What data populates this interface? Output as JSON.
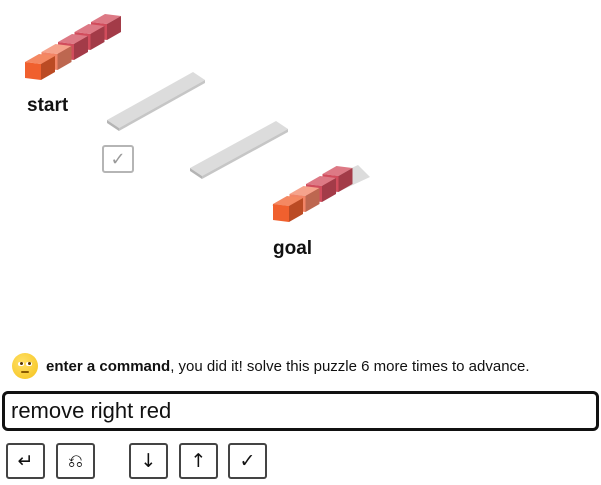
{
  "puzzle": {
    "start_label": "start",
    "goal_label": "goal",
    "done_check_glyph": "✓",
    "start_blocks": [
      "orange",
      "salmon",
      "red",
      "red",
      "red"
    ],
    "goal_blocks": [
      "orange",
      "salmon",
      "red",
      "red"
    ],
    "colors": {
      "orange": "#f0602e",
      "salmon": "#f28466",
      "red": "#d14c5c"
    }
  },
  "status": {
    "emoji_icon": "face-with-rolling-eyes-icon",
    "bold_text": "enter a command",
    "message": ", you did it! solve this puzzle 6 more times to advance."
  },
  "command": {
    "value": "remove right red"
  },
  "buttons": {
    "submit": "↵",
    "undo": "⎌",
    "down": "↓",
    "up": "↑",
    "check": "✓"
  }
}
